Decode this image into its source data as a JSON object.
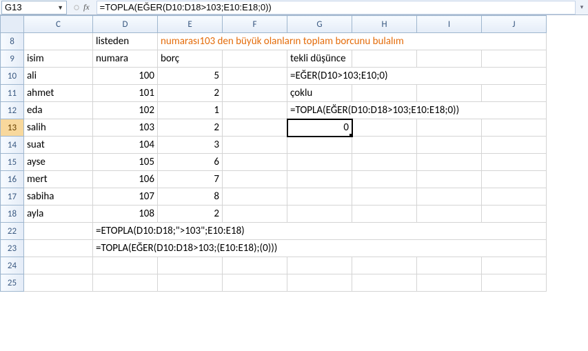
{
  "name_box": "G13",
  "formula": "=TOPLA(EĞER(D10:D18>103;E10:E18;0))",
  "col_headers": [
    "C",
    "D",
    "E",
    "F",
    "G",
    "H",
    "I",
    "J"
  ],
  "rows": [
    {
      "n": "8",
      "C": "",
      "D": "listeden",
      "E_span": "numarası103 den büyük olanların toplam borcunu bulalım",
      "E_class": "orange"
    },
    {
      "n": "9",
      "C": "isim",
      "D": "numara",
      "E": "borç",
      "G": "tekli düşünce"
    },
    {
      "n": "10",
      "C": "ali",
      "Dnum": "100",
      "Enum": "5",
      "G_span": "=EĞER(D10>103;E10;0)"
    },
    {
      "n": "11",
      "C": "ahmet",
      "Dnum": "101",
      "Enum": "2",
      "G": "çoklu"
    },
    {
      "n": "12",
      "C": "eda",
      "Dnum": "102",
      "Enum": "1",
      "G_span": "=TOPLA(EĞER(D10:D18>103;E10:E18;0))"
    },
    {
      "n": "13",
      "C": "salih",
      "Dnum": "103",
      "Enum": "2",
      "Gnum": "0",
      "Gsel": true,
      "rowsel": true
    },
    {
      "n": "14",
      "C": "suat",
      "Dnum": "104",
      "Enum": "3"
    },
    {
      "n": "15",
      "C": "ayse",
      "Dnum": "105",
      "Enum": "6"
    },
    {
      "n": "16",
      "C": "mert",
      "Dnum": "106",
      "Enum": "7"
    },
    {
      "n": "17",
      "C": "sabiha",
      "Dnum": "107",
      "Enum": "8"
    },
    {
      "n": "18",
      "C": "ayla",
      "Dnum": "108",
      "Enum": "2"
    },
    {
      "n": "22",
      "D_span": "=ETOPLA(D10:D18;\">103\";E10:E18)"
    },
    {
      "n": "23",
      "D_span": "=TOPLA(EĞER(D10:D18>103;(E10:E18);(0)))"
    },
    {
      "n": "24"
    },
    {
      "n": "25"
    }
  ],
  "chart_data": {
    "type": "table",
    "title": "numarası103 den büyük olanların toplam borcunu bulalım",
    "columns": [
      "isim",
      "numara",
      "borç"
    ],
    "rows": [
      [
        "ali",
        100,
        5
      ],
      [
        "ahmet",
        101,
        2
      ],
      [
        "eda",
        102,
        1
      ],
      [
        "salih",
        103,
        2
      ],
      [
        "suat",
        104,
        3
      ],
      [
        "ayse",
        105,
        6
      ],
      [
        "mert",
        106,
        7
      ],
      [
        "sabiha",
        107,
        8
      ],
      [
        "ayla",
        108,
        2
      ]
    ],
    "formulas": {
      "tekli": "=EĞER(D10>103;E10;0)",
      "çoklu": "=TOPLA(EĞER(D10:D18>103;E10:E18;0))",
      "etopla": "=ETOPLA(D10:D18;\">103\";E10:E18)",
      "topla_eger": "=TOPLA(EĞER(D10:D18>103;(E10:E18);(0)))"
    },
    "result_G13": 0
  }
}
